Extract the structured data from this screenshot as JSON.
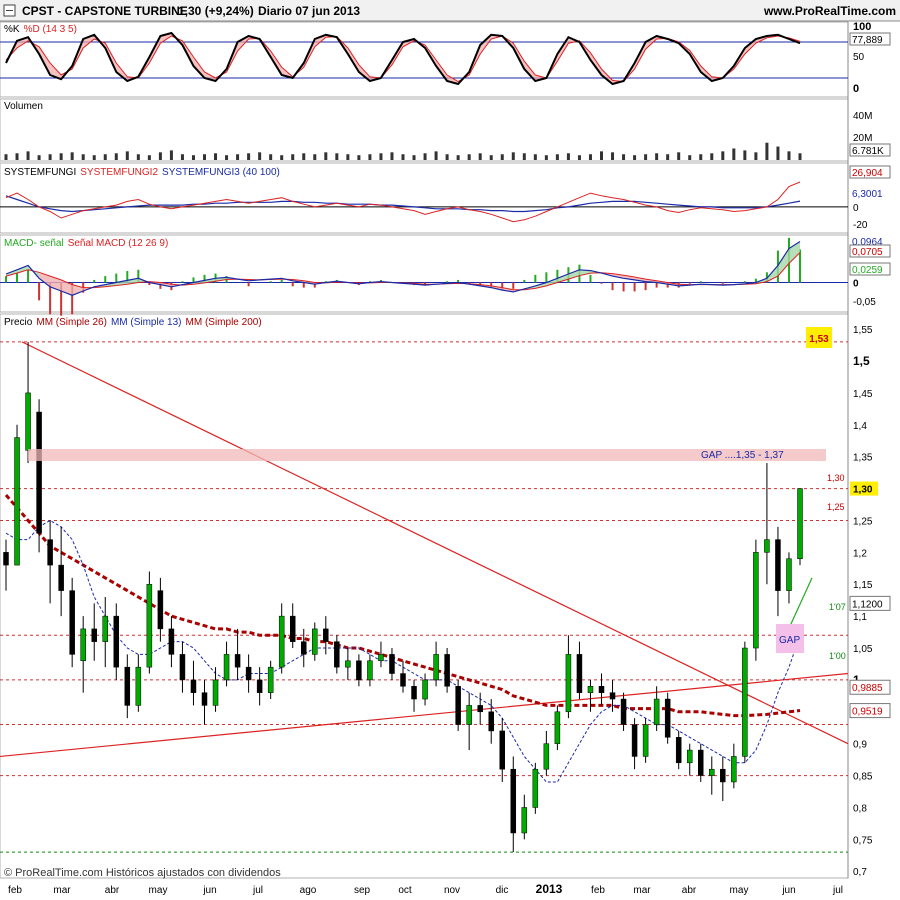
{
  "header": {
    "title": "CPST - CAPSTONE TURBINE",
    "change": "1,30 (+9,24%)",
    "period": "Diario  07 jun 2013",
    "site": "www.ProRealTime.com"
  },
  "footer": {
    "copyright": "© ProRealTime.com  Históricos ajustados con dividendos"
  },
  "x_axis": {
    "labels": [
      "feb",
      "mar",
      "abr",
      "may",
      "jun",
      "jul",
      "ago",
      "sep",
      "oct",
      "nov",
      "dic",
      "2013",
      "feb",
      "mar",
      "abr",
      "may",
      "jun",
      "jul"
    ]
  },
  "colors": {
    "up": "#00aa00",
    "down": "#000000",
    "grid": "#aaaaaa",
    "red": "#dd2222",
    "blue": "#1a2aa8",
    "green": "#22aa22",
    "highlight": "#ffee00"
  },
  "chart_data": [
    {
      "type": "line",
      "panel": "stochastic",
      "legend": [
        "%K",
        "%D (14 3 5)"
      ],
      "ticks": [
        "100",
        "50",
        "0"
      ],
      "levels": [
        80,
        20
      ],
      "ylim": [
        0,
        100
      ],
      "last_value_label": "77,889",
      "series": [
        {
          "name": "%K",
          "values": [
            45,
            82,
            88,
            60,
            25,
            18,
            40,
            85,
            92,
            70,
            30,
            15,
            22,
            55,
            90,
            95,
            75,
            40,
            20,
            15,
            35,
            80,
            90,
            85,
            55,
            25,
            20,
            45,
            85,
            92,
            88,
            60,
            30,
            15,
            20,
            50,
            80,
            85,
            70,
            40,
            15,
            10,
            30,
            75,
            92,
            90,
            70,
            35,
            15,
            20,
            60,
            88,
            80,
            50,
            25,
            10,
            15,
            45,
            80,
            90,
            85,
            78,
            60,
            30,
            15,
            20,
            40,
            70,
            85,
            90,
            92,
            85,
            78
          ]
        },
        {
          "name": "%D",
          "values": [
            50,
            70,
            82,
            72,
            45,
            25,
            35,
            70,
            85,
            78,
            45,
            22,
            20,
            45,
            78,
            90,
            82,
            55,
            30,
            20,
            30,
            65,
            85,
            86,
            65,
            38,
            22,
            38,
            72,
            88,
            89,
            70,
            42,
            22,
            20,
            42,
            72,
            82,
            75,
            50,
            25,
            14,
            25,
            60,
            85,
            90,
            78,
            48,
            25,
            20,
            48,
            78,
            82,
            62,
            35,
            16,
            14,
            35,
            68,
            85,
            86,
            80,
            66,
            40,
            22,
            20,
            35,
            60,
            78,
            87,
            90,
            87,
            81
          ]
        }
      ]
    },
    {
      "type": "bar",
      "panel": "volume",
      "legend": [
        "Volumen"
      ],
      "ticks": [
        "40M",
        "20M"
      ],
      "ylim": [
        0,
        50
      ],
      "last_value_label": "6.781K",
      "values": [
        6,
        7,
        9,
        5,
        6,
        7,
        8,
        6,
        5,
        6,
        7,
        9,
        6,
        5,
        8,
        10,
        6,
        5,
        6,
        7,
        5,
        6,
        7,
        8,
        6,
        5,
        6,
        7,
        6,
        8,
        7,
        6,
        5,
        6,
        7,
        8,
        6,
        5,
        7,
        9,
        6,
        5,
        6,
        7,
        5,
        6,
        8,
        7,
        6,
        5,
        6,
        7,
        5,
        6,
        9,
        8,
        6,
        5,
        6,
        7,
        6,
        8,
        5,
        6,
        7,
        9,
        12,
        10,
        8,
        18,
        14,
        9,
        7
      ]
    },
    {
      "type": "line",
      "panel": "systemfungi",
      "legend": [
        "SYSTEMFUNGI",
        "SYSTEMFUNGI2",
        "SYSTEMFUNGI3 (40 100)"
      ],
      "ticks": [
        "0",
        "-20"
      ],
      "ylim": [
        -25,
        40
      ],
      "last_value_labels": [
        "26,904",
        "6,3001"
      ],
      "series": [
        {
          "name": "SYSTEMFUNGI2",
          "values": [
            10,
            15,
            8,
            0,
            -5,
            -12,
            -8,
            -4,
            -2,
            0,
            2,
            6,
            8,
            3,
            0,
            -2,
            0,
            2,
            4,
            6,
            8,
            6,
            4,
            6,
            8,
            10,
            6,
            3,
            0,
            2,
            4,
            2,
            0,
            3,
            2,
            0,
            -2,
            -4,
            -8,
            -5,
            -2,
            0,
            -3,
            -5,
            -8,
            -12,
            -16,
            -14,
            -10,
            -5,
            0,
            5,
            10,
            15,
            12,
            10,
            8,
            5,
            2,
            0,
            -4,
            -6,
            -3,
            -1,
            -2,
            -3,
            -5,
            -4,
            -2,
            0,
            8,
            22,
            27
          ]
        },
        {
          "name": "SYSTEMFUNGI3",
          "values": [
            12,
            8,
            4,
            0,
            -2,
            -4,
            -5,
            -4,
            -3,
            -2,
            -1,
            0,
            1,
            2,
            2,
            2,
            2,
            3,
            3,
            4,
            4,
            5,
            5,
            5,
            5,
            6,
            6,
            5,
            5,
            4,
            4,
            3,
            3,
            3,
            2,
            2,
            1,
            0,
            -1,
            -2,
            -2,
            -2,
            -3,
            -3,
            -4,
            -4,
            -5,
            -5,
            -4,
            -3,
            -1,
            0,
            2,
            4,
            5,
            6,
            6,
            6,
            5,
            4,
            3,
            2,
            1,
            0,
            0,
            -1,
            -1,
            -1,
            -1,
            0,
            2,
            4,
            6.3
          ]
        }
      ]
    },
    {
      "type": "line",
      "panel": "macd",
      "legend": [
        "MACD-",
        "señal",
        "Señal MACD (12 26 9)"
      ],
      "ticks": [
        "0",
        "-0,05"
      ],
      "ylim": [
        -0.06,
        0.1
      ],
      "last_value_labels": [
        "0,0964",
        "0,0705",
        "0,0259"
      ],
      "series": [
        {
          "name": "MACD",
          "values": [
            0.02,
            0.03,
            0.04,
            0.01,
            -0.01,
            -0.02,
            -0.03,
            -0.02,
            -0.01,
            -0.005,
            0.0,
            0.005,
            0.01,
            0.0,
            -0.005,
            -0.01,
            -0.005,
            0.0,
            0.005,
            0.01,
            0.012,
            0.008,
            0.004,
            0.006,
            0.008,
            0.01,
            0.004,
            0.0,
            -0.004,
            0.0,
            0.003,
            0.0,
            -0.003,
            0.0,
            0.002,
            0.0,
            -0.002,
            -0.004,
            -0.006,
            -0.004,
            -0.002,
            0.0,
            -0.004,
            -0.008,
            -0.012,
            -0.018,
            -0.022,
            -0.015,
            -0.008,
            0.0,
            0.01,
            0.02,
            0.03,
            0.028,
            0.022,
            0.015,
            0.01,
            0.006,
            0.002,
            0.0,
            -0.004,
            -0.008,
            -0.006,
            -0.004,
            -0.005,
            -0.006,
            -0.005,
            -0.003,
            0.0,
            0.01,
            0.04,
            0.08,
            0.0964
          ]
        },
        {
          "name": "Señal",
          "values": [
            0.015,
            0.022,
            0.03,
            0.024,
            0.015,
            0.006,
            -0.005,
            -0.012,
            -0.012,
            -0.01,
            -0.007,
            -0.004,
            0.0,
            0.002,
            0.0,
            -0.004,
            -0.006,
            -0.004,
            -0.001,
            0.003,
            0.007,
            0.008,
            0.007,
            0.006,
            0.007,
            0.008,
            0.007,
            0.004,
            0.0,
            -0.001,
            0.001,
            0.0,
            -0.001,
            -0.001,
            0.0,
            0.0,
            -0.001,
            -0.002,
            -0.004,
            -0.004,
            -0.003,
            -0.002,
            -0.003,
            -0.005,
            -0.008,
            -0.012,
            -0.017,
            -0.017,
            -0.014,
            -0.008,
            0.0,
            0.008,
            0.016,
            0.022,
            0.023,
            0.021,
            0.017,
            0.013,
            0.008,
            0.004,
            0.0,
            -0.004,
            -0.005,
            -0.005,
            -0.005,
            -0.005,
            -0.005,
            -0.004,
            -0.003,
            0.002,
            0.015,
            0.045,
            0.0705
          ]
        }
      ]
    },
    {
      "type": "candlestick",
      "panel": "price",
      "legend": [
        "Precio",
        "MM (Simple 26)",
        "MM (Simple 13)",
        "MM (Simple 200)"
      ],
      "ylim": [
        0.68,
        1.58
      ],
      "ticks": [
        "1,55",
        "1,5",
        "1,45",
        "1,4",
        "1,35",
        "1,3",
        "1,25",
        "1,2",
        "1,15",
        "1,1",
        "1,05",
        "1",
        "0,95",
        "0,9",
        "0,85",
        "0,8",
        "0,75",
        "0,7"
      ],
      "last_price_label": "1,30",
      "ohlc": [
        [
          1.2,
          1.22,
          1.14,
          1.18
        ],
        [
          1.18,
          1.4,
          1.18,
          1.38
        ],
        [
          1.36,
          1.53,
          1.34,
          1.45
        ],
        [
          1.42,
          1.44,
          1.2,
          1.23
        ],
        [
          1.22,
          1.25,
          1.12,
          1.18
        ],
        [
          1.18,
          1.24,
          1.1,
          1.14
        ],
        [
          1.14,
          1.16,
          1.02,
          1.04
        ],
        [
          1.03,
          1.1,
          0.98,
          1.08
        ],
        [
          1.08,
          1.12,
          1.03,
          1.06
        ],
        [
          1.06,
          1.13,
          1.02,
          1.1
        ],
        [
          1.1,
          1.12,
          1.0,
          1.02
        ],
        [
          1.02,
          1.04,
          0.94,
          0.96
        ],
        [
          0.96,
          1.04,
          0.95,
          1.02
        ],
        [
          1.02,
          1.17,
          1.01,
          1.15
        ],
        [
          1.14,
          1.16,
          1.06,
          1.08
        ],
        [
          1.08,
          1.1,
          1.02,
          1.04
        ],
        [
          1.04,
          1.06,
          0.98,
          1.0
        ],
        [
          1.0,
          1.03,
          0.96,
          0.98
        ],
        [
          0.98,
          1.0,
          0.93,
          0.96
        ],
        [
          0.96,
          1.02,
          0.95,
          1.0
        ],
        [
          1.0,
          1.06,
          0.99,
          1.04
        ],
        [
          1.04,
          1.08,
          1.0,
          1.02
        ],
        [
          1.02,
          1.04,
          0.98,
          1.0
        ],
        [
          1.0,
          1.02,
          0.96,
          0.98
        ],
        [
          0.98,
          1.03,
          0.97,
          1.02
        ],
        [
          1.02,
          1.12,
          1.01,
          1.1
        ],
        [
          1.1,
          1.12,
          1.05,
          1.06
        ],
        [
          1.06,
          1.08,
          1.02,
          1.04
        ],
        [
          1.04,
          1.09,
          1.03,
          1.08
        ],
        [
          1.08,
          1.1,
          1.04,
          1.06
        ],
        [
          1.06,
          1.07,
          1.01,
          1.02
        ],
        [
          1.02,
          1.05,
          1.0,
          1.03
        ],
        [
          1.03,
          1.04,
          0.99,
          1.0
        ],
        [
          1.0,
          1.04,
          0.99,
          1.03
        ],
        [
          1.03,
          1.06,
          1.02,
          1.04
        ],
        [
          1.04,
          1.05,
          1.0,
          1.01
        ],
        [
          1.01,
          1.03,
          0.98,
          0.99
        ],
        [
          0.99,
          1.0,
          0.95,
          0.97
        ],
        [
          0.97,
          1.01,
          0.96,
          1.0
        ],
        [
          1.0,
          1.06,
          0.99,
          1.04
        ],
        [
          1.04,
          1.05,
          0.98,
          0.99
        ],
        [
          0.99,
          1.0,
          0.92,
          0.93
        ],
        [
          0.93,
          0.98,
          0.89,
          0.96
        ],
        [
          0.96,
          0.98,
          0.93,
          0.95
        ],
        [
          0.95,
          0.97,
          0.9,
          0.92
        ],
        [
          0.92,
          0.94,
          0.84,
          0.86
        ],
        [
          0.86,
          0.88,
          0.73,
          0.76
        ],
        [
          0.76,
          0.82,
          0.75,
          0.8
        ],
        [
          0.8,
          0.87,
          0.79,
          0.86
        ],
        [
          0.86,
          0.92,
          0.85,
          0.9
        ],
        [
          0.9,
          0.96,
          0.89,
          0.95
        ],
        [
          0.95,
          1.07,
          0.94,
          1.04
        ],
        [
          1.04,
          1.06,
          0.97,
          0.98
        ],
        [
          0.98,
          1.0,
          0.95,
          0.99
        ],
        [
          0.99,
          1.01,
          0.96,
          0.98
        ],
        [
          0.98,
          1.0,
          0.95,
          0.97
        ],
        [
          0.97,
          0.98,
          0.92,
          0.93
        ],
        [
          0.93,
          0.94,
          0.86,
          0.88
        ],
        [
          0.88,
          0.94,
          0.87,
          0.93
        ],
        [
          0.93,
          0.99,
          0.92,
          0.97
        ],
        [
          0.97,
          0.98,
          0.9,
          0.91
        ],
        [
          0.91,
          0.92,
          0.86,
          0.87
        ],
        [
          0.87,
          0.9,
          0.85,
          0.89
        ],
        [
          0.89,
          0.9,
          0.84,
          0.85
        ],
        [
          0.85,
          0.88,
          0.82,
          0.86
        ],
        [
          0.86,
          0.88,
          0.81,
          0.84
        ],
        [
          0.84,
          0.9,
          0.83,
          0.88
        ],
        [
          0.88,
          1.06,
          0.87,
          1.05
        ],
        [
          1.05,
          1.22,
          1.03,
          1.2
        ],
        [
          1.2,
          1.34,
          1.15,
          1.22
        ],
        [
          1.22,
          1.24,
          1.1,
          1.14
        ],
        [
          1.14,
          1.2,
          1.12,
          1.19
        ],
        [
          1.19,
          1.3,
          1.18,
          1.3
        ]
      ],
      "sma200": [
        1.29,
        1.27,
        1.25,
        1.23,
        1.21,
        1.2,
        1.19,
        1.18,
        1.17,
        1.16,
        1.15,
        1.14,
        1.13,
        1.12,
        1.11,
        1.1,
        1.095,
        1.09,
        1.085,
        1.08,
        1.08,
        1.075,
        1.075,
        1.07,
        1.07,
        1.07,
        1.065,
        1.065,
        1.06,
        1.06,
        1.055,
        1.05,
        1.05,
        1.045,
        1.04,
        1.035,
        1.03,
        1.025,
        1.02,
        1.015,
        1.01,
        1.005,
        1.0,
        0.995,
        0.99,
        0.985,
        0.975,
        0.97,
        0.965,
        0.96,
        0.96,
        0.96,
        0.96,
        0.96,
        0.96,
        0.96,
        0.955,
        0.955,
        0.955,
        0.955,
        0.955,
        0.95,
        0.95,
        0.95,
        0.948,
        0.946,
        0.944,
        0.944,
        0.945,
        0.946,
        0.948,
        0.95,
        0.952
      ],
      "sma13": [
        1.23,
        1.22,
        1.22,
        1.24,
        1.25,
        1.24,
        1.22,
        1.18,
        1.13,
        1.1,
        1.07,
        1.05,
        1.04,
        1.04,
        1.05,
        1.06,
        1.06,
        1.05,
        1.03,
        1.01,
        1.0,
        1.0,
        1.01,
        1.01,
        1.01,
        1.02,
        1.03,
        1.04,
        1.05,
        1.05,
        1.05,
        1.05,
        1.05,
        1.04,
        1.03,
        1.03,
        1.02,
        1.01,
        1.0,
        1.0,
        1.0,
        0.99,
        0.98,
        0.97,
        0.96,
        0.94,
        0.91,
        0.88,
        0.86,
        0.84,
        0.84,
        0.87,
        0.9,
        0.93,
        0.95,
        0.96,
        0.96,
        0.95,
        0.94,
        0.93,
        0.93,
        0.92,
        0.91,
        0.9,
        0.89,
        0.88,
        0.87,
        0.87,
        0.89,
        0.93,
        0.98,
        1.02,
        1.07
      ]
    }
  ],
  "annotations": {
    "gap_top_label": "GAP ....1,35 - 1,37",
    "gap_box_label": "GAP",
    "resistance_label": "1,53",
    "level_labels": [
      "1,30",
      "1,25",
      "1'07",
      "1'00"
    ],
    "price_tags": [
      "1,1200",
      "0,9885",
      "0,9519"
    ]
  }
}
